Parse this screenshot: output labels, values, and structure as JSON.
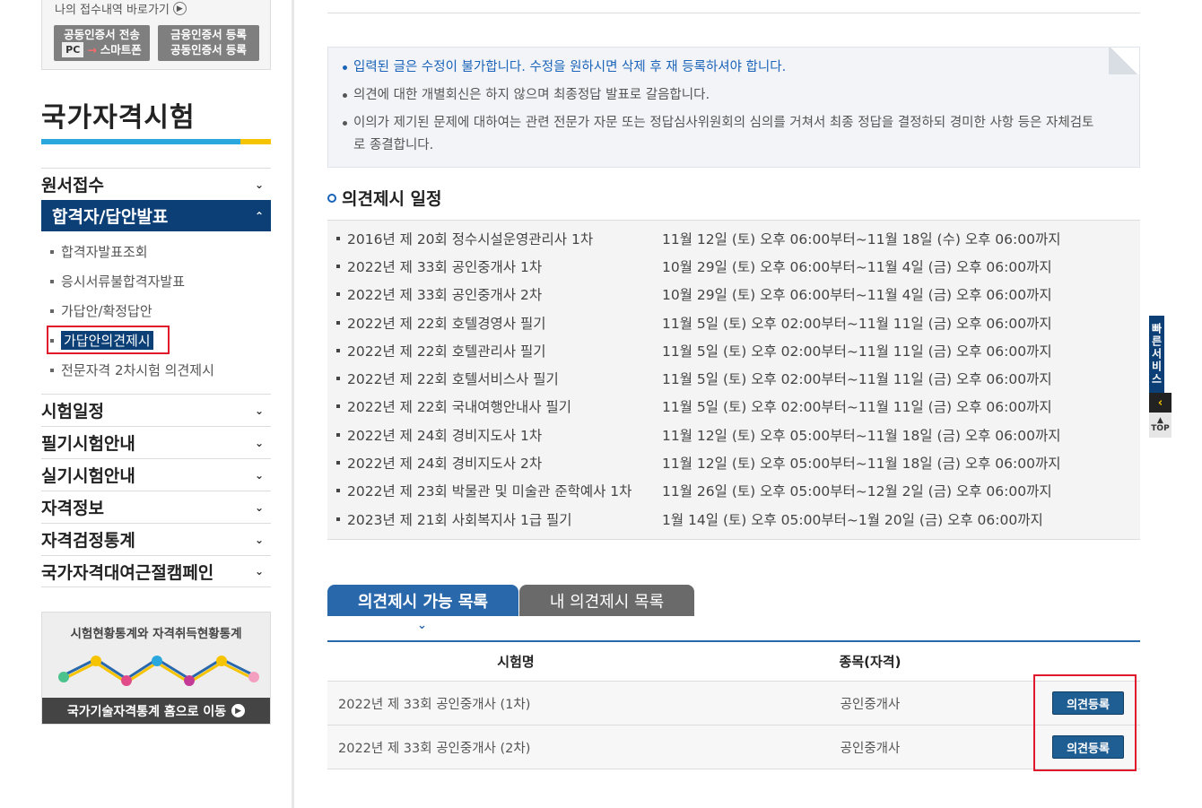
{
  "sidebar": {
    "quick_link": "나의 접수내역 바로가기",
    "cert_btn1_line1": "공동인증서 전송",
    "cert_btn1_pc": "PC",
    "cert_btn1_phone": "스마트폰",
    "cert_btn2_line1": "금융인증서 등록",
    "cert_btn2_line2": "공동인증서 등록",
    "title": "국가자격시험",
    "menu": [
      {
        "label": "원서접수"
      },
      {
        "label": "합격자/답안발표"
      },
      {
        "label": "시험일정"
      },
      {
        "label": "필기시험안내"
      },
      {
        "label": "실기시험안내"
      },
      {
        "label": "자격정보"
      },
      {
        "label": "자격검정통계"
      },
      {
        "label": "국가자격대여근절캠페인"
      }
    ],
    "submenu": [
      {
        "label": "합격자발표조회"
      },
      {
        "label": "응시서류불합격자발표"
      },
      {
        "label": "가답안/확정답안"
      },
      {
        "label": "가답안의견제시"
      },
      {
        "label": "전문자격 2차시험 의견제시"
      }
    ],
    "banner_title": "시험현황통계와 자격취득현황통계",
    "banner_link": "국가기술자격통계 홈으로 이동"
  },
  "notice": [
    "입력된 글은 수정이 불가합니다. 수정을 원하시면 삭제 후 재 등록하셔야 합니다.",
    "의견에 대한 개별회신은 하지 않으며 최종정답 발표로 갈음합니다.",
    "이의가 제기된 문제에 대하여는 관련 전문가 자문 또는 정답심사위원회의 심의를 거쳐서 최종 정답을 결정하되 경미한 사항 등은 자체검토로 종결합니다."
  ],
  "schedule_title": "의견제시 일정",
  "schedule": [
    {
      "name": "2016년 제 20회 정수시설운영관리사 1차",
      "period": "11월 12일 (토) 오후 06:00부터~11월 18일 (수) 오후 06:00까지"
    },
    {
      "name": "2022년 제 33회 공인중개사 1차",
      "period": "10월 29일 (토) 오후 06:00부터~11월 4일 (금) 오후 06:00까지"
    },
    {
      "name": "2022년 제 33회 공인중개사 2차",
      "period": "10월 29일 (토) 오후 06:00부터~11월 4일 (금) 오후 06:00까지"
    },
    {
      "name": "2022년 제 22회 호텔경영사 필기",
      "period": "11월 5일 (토) 오후 02:00부터~11월 11일 (금) 오후 06:00까지"
    },
    {
      "name": "2022년 제 22회 호텔관리사 필기",
      "period": "11월 5일 (토) 오후 02:00부터~11월 11일 (금) 오후 06:00까지"
    },
    {
      "name": "2022년 제 22회 호텔서비스사 필기",
      "period": "11월 5일 (토) 오후 02:00부터~11월 11일 (금) 오후 06:00까지"
    },
    {
      "name": "2022년 제 22회 국내여행안내사 필기",
      "period": "11월 5일 (토) 오후 02:00부터~11월 11일 (금) 오후 06:00까지"
    },
    {
      "name": "2022년 제 24회 경비지도사 1차",
      "period": "11월 12일 (토) 오후 05:00부터~11월 18일 (금) 오후 06:00까지"
    },
    {
      "name": "2022년 제 24회 경비지도사 2차",
      "period": "11월 12일 (토) 오후 05:00부터~11월 18일 (금) 오후 06:00까지"
    },
    {
      "name": "2022년 제 23회 박물관 및 미술관 준학예사 1차",
      "period": "11월 26일 (토) 오후 05:00부터~12월 2일 (금) 오후 06:00까지"
    },
    {
      "name": "2023년 제 21회 사회복지사 1급 필기",
      "period": "1월 14일 (토) 오후 05:00부터~1월 20일 (금) 오후 06:00까지"
    }
  ],
  "tabs": {
    "active": "의견제시 가능 목록",
    "inactive": "내 의견제시 목록"
  },
  "list": {
    "headers": [
      "시험명",
      "종목(자격)"
    ],
    "rows": [
      {
        "exam": "2022년 제 33회 공인중개사 (1차)",
        "item": "공인중개사",
        "button": "의견등록"
      },
      {
        "exam": "2022년 제 33회 공인중개사 (2차)",
        "item": "공인중개사",
        "button": "의견등록"
      }
    ]
  },
  "quick_service": {
    "label": "빠른서비스",
    "top": "TOP"
  },
  "colors": {
    "navy": "#0b3f76",
    "blue": "#2a68ac",
    "highlight": "#e0182b",
    "accent_yellow": "#f6c300",
    "accent_cyan": "#2aa8dd"
  }
}
